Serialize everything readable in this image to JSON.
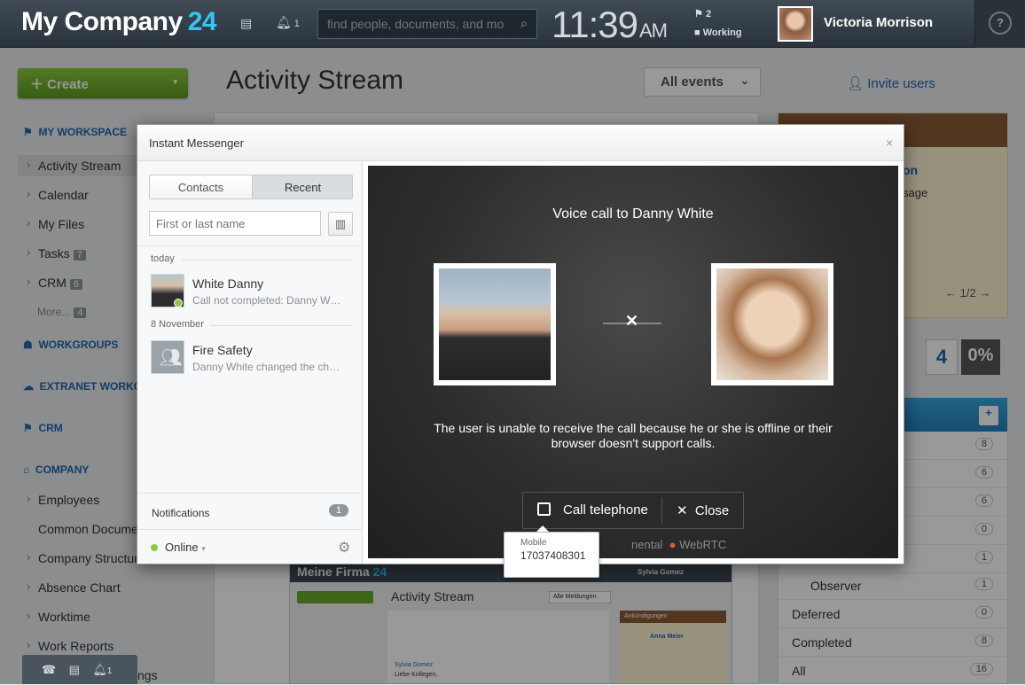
{
  "header": {
    "logo_name": "My Company",
    "logo_num": "24",
    "bell_count": "1",
    "search_placeholder": "find people, documents, and more",
    "clock_time": "11:39",
    "clock_ampm": "AM",
    "flag_count": "2",
    "work_status": "Working",
    "user_name": "Victoria Morrison",
    "help": "?"
  },
  "sidebar": {
    "create_label": "Create",
    "my_workspace": "MY WORKSPACE",
    "items": [
      {
        "label": "Activity Stream"
      },
      {
        "label": "Calendar"
      },
      {
        "label": "My Files"
      },
      {
        "label": "Tasks",
        "count": "7"
      },
      {
        "label": "CRM",
        "count": "6"
      },
      {
        "label": "More...",
        "count": "4"
      }
    ],
    "workgroups": "WORKGROUPS",
    "extranet": "EXTRANET WORKGROUPS",
    "crm": "CRM",
    "company": "COMPANY",
    "company_items": [
      {
        "label": "Employees"
      },
      {
        "label": "Common Documents"
      },
      {
        "label": "Company Structure"
      },
      {
        "label": "Absence Chart"
      },
      {
        "label": "Worktime"
      },
      {
        "label": "Work Reports"
      },
      {
        "label": "ngs"
      }
    ]
  },
  "main": {
    "title": "Activity Stream",
    "all_events": "All events",
    "invite": "Invite users",
    "right_link": "on",
    "right_text": "sage",
    "pager": "1/2",
    "big_num": "4",
    "percent": "0%"
  },
  "tasks": {
    "rows": [
      {
        "label": "",
        "count": "8"
      },
      {
        "label": "",
        "count": "6"
      },
      {
        "label": "",
        "count": "6"
      },
      {
        "label": "",
        "count": "0"
      },
      {
        "label": "",
        "count": "1"
      },
      {
        "label": "Observer",
        "count": "1"
      },
      {
        "label": "Deferred",
        "count": "0"
      },
      {
        "label": "Completed",
        "count": "8"
      },
      {
        "label": "All",
        "count": "16"
      }
    ]
  },
  "preview": {
    "name": "Meine Firma",
    "num": "24",
    "title": "Activity Stream",
    "btn": "Alle Meldungen",
    "announce": "Ankündigungen",
    "person": "Anna Meier",
    "person2": "Sylvia Gomez",
    "greet": "Liebe Kollegen,"
  },
  "messenger": {
    "title": "Instant Messenger",
    "close": "×",
    "tab_contacts": "Contacts",
    "tab_recent": "Recent",
    "search_placeholder": "First or last name",
    "group_today": "today",
    "group_nov": "8 November",
    "contacts": [
      {
        "name": "White Danny",
        "sub": "Call not completed: Danny White is not online or is not using an application supporting calls."
      },
      {
        "name": "Fire Safety",
        "sub": "Danny White changed the chat title"
      }
    ],
    "notifications": "Notifications",
    "notif_count": "1",
    "status": "Online"
  },
  "call": {
    "heading": "Voice call to Danny White",
    "message": "The user is unable to receive the call because he or she is offline or their browser doesn't support calls.",
    "btn_call": "Call telephone",
    "btn_close": "Close",
    "webrtc_a": "nental",
    "webrtc_b": "WebRTC",
    "tooltip_label": "Mobile",
    "tooltip_value": "17037408301"
  },
  "bottom": {
    "bell_count": "1"
  }
}
